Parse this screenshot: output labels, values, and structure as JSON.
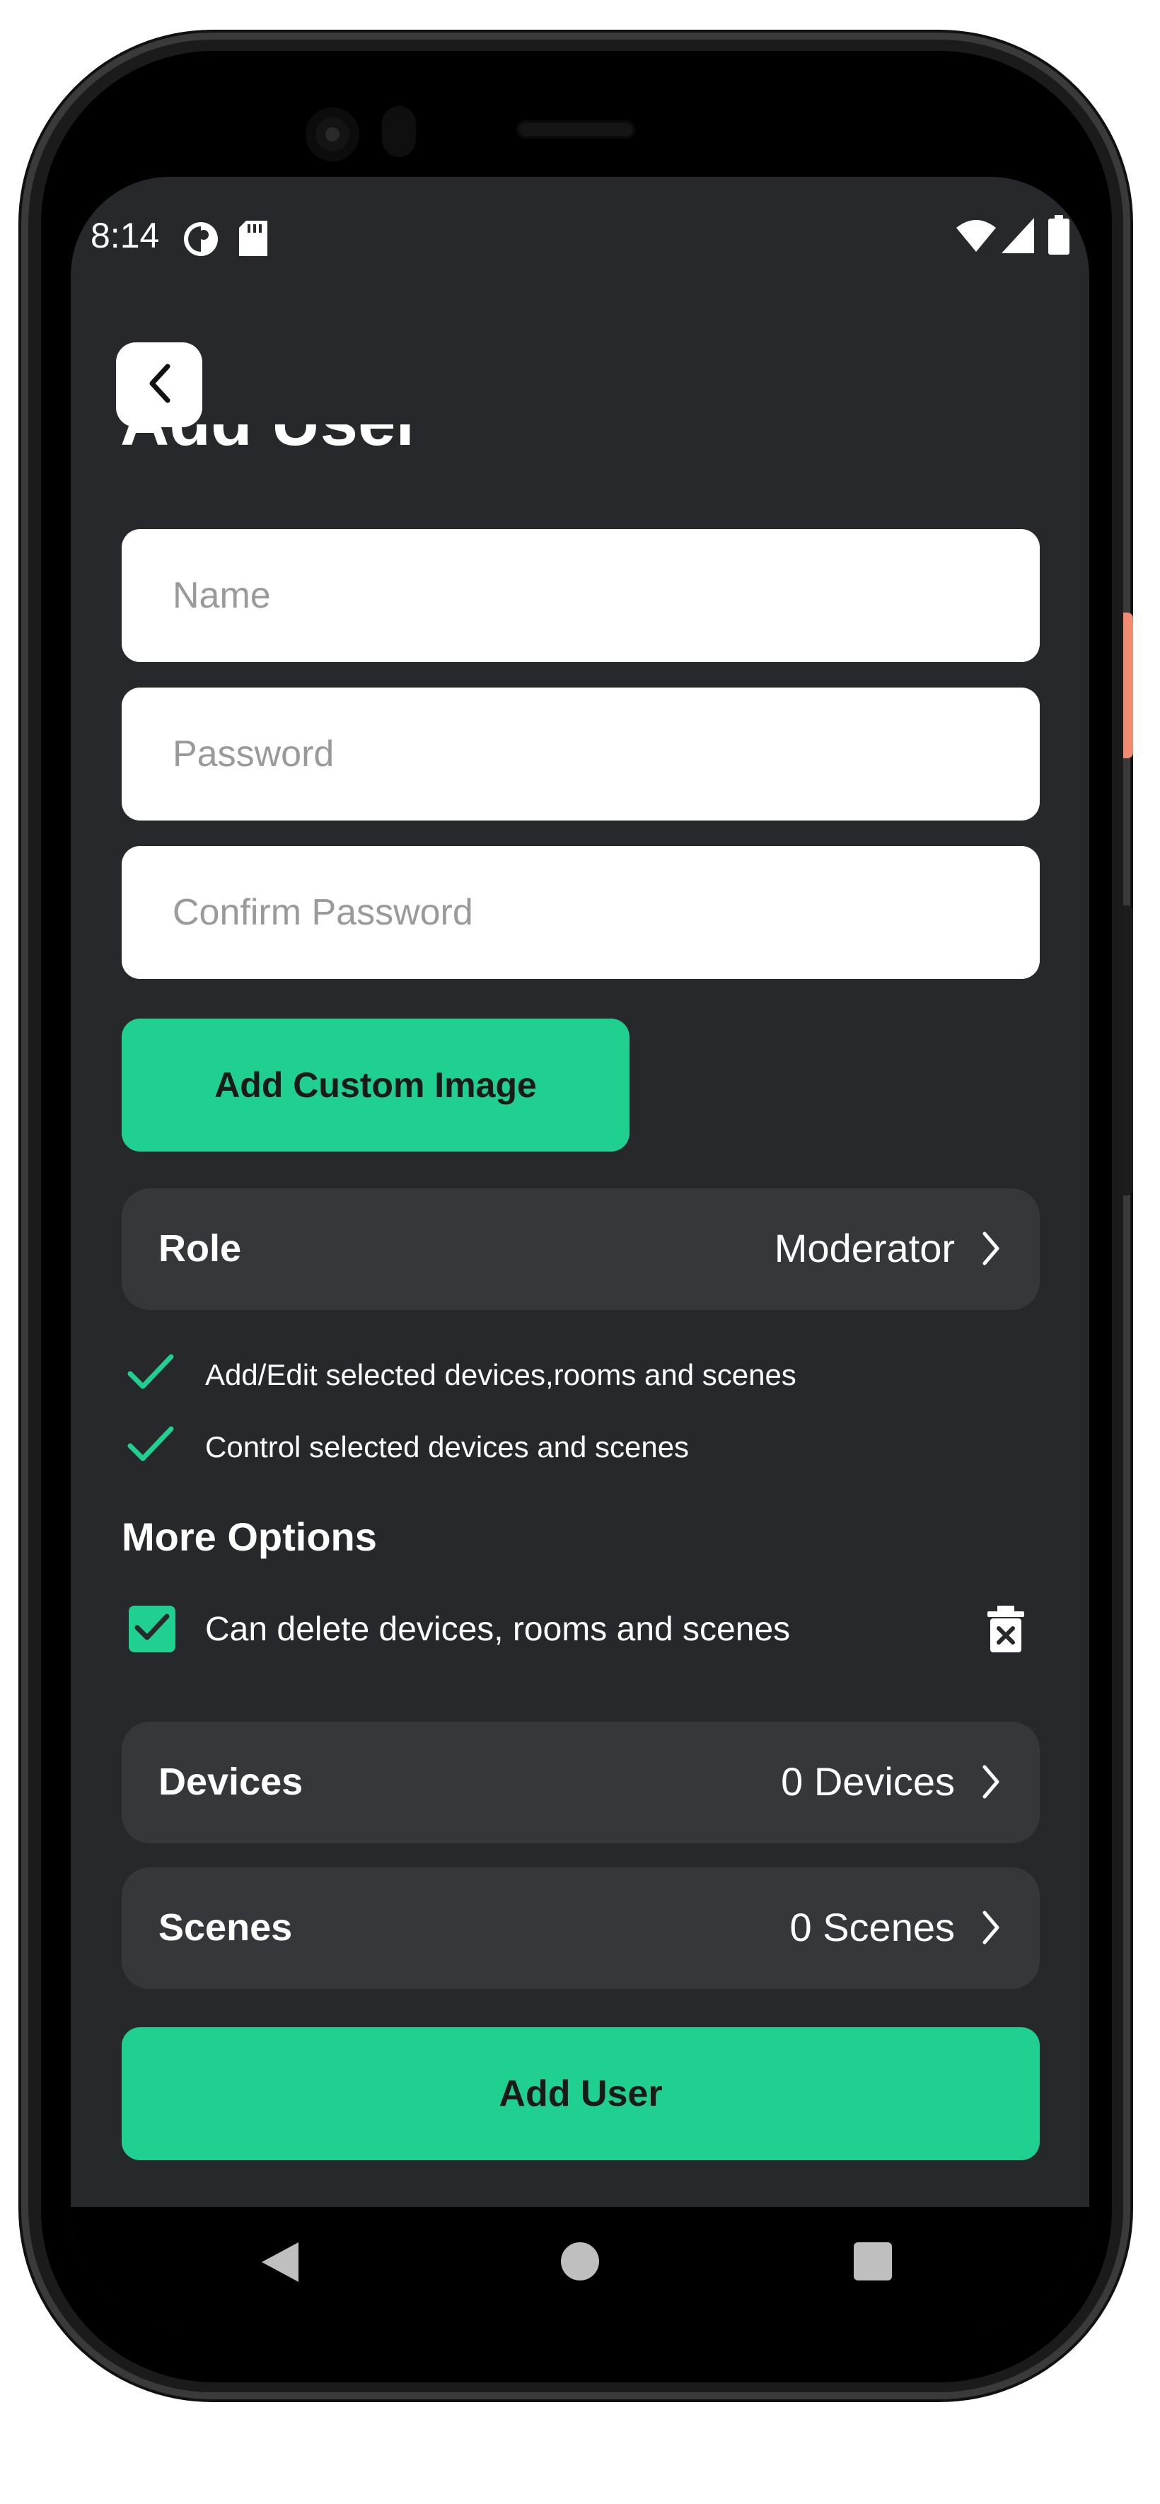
{
  "status_bar": {
    "time": "8:14",
    "icons": [
      "pinwheel-icon",
      "sd-card-icon",
      "wifi-icon",
      "cell-signal-icon",
      "battery-icon"
    ]
  },
  "header": {
    "back_icon": "chevron-left-icon",
    "title": "Add User"
  },
  "form": {
    "name_placeholder": "Name",
    "password_placeholder": "Password",
    "confirm_password_placeholder": "Confirm Password"
  },
  "custom_image_button": "Add Custom Image",
  "role": {
    "label": "Role",
    "value": "Moderator"
  },
  "permissions": [
    "Add/Edit selected devices,rooms and scenes",
    "Control selected devices and scenes"
  ],
  "more_options": {
    "title": "More Options",
    "delete_option": {
      "label": "Can delete devices, rooms and scenes",
      "checked": true
    }
  },
  "devices": {
    "label": "Devices",
    "value": "0 Devices"
  },
  "scenes": {
    "label": "Scenes",
    "value": "0 Scenes"
  },
  "submit_button": "Add User",
  "colors": {
    "accent": "#20d090",
    "background": "#27282b",
    "card": "#36373b"
  },
  "nav_bar": {
    "icons": [
      "back-triangle-icon",
      "home-circle-icon",
      "recents-square-icon"
    ]
  }
}
